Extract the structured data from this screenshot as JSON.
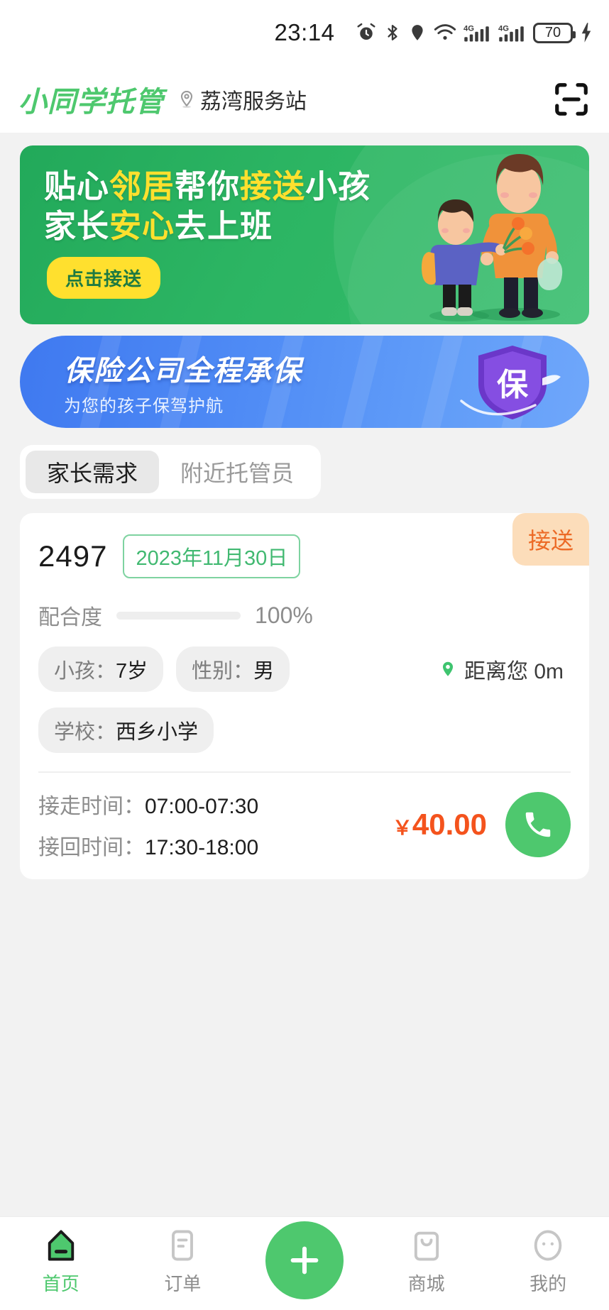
{
  "status_bar": {
    "time": "23:14",
    "battery_level": "70",
    "icons": [
      "alarm-icon",
      "bluetooth-icon",
      "location-icon",
      "wifi-icon",
      "signal-4g-icon",
      "signal-4g-icon",
      "battery-icon",
      "charging-bolt-icon"
    ],
    "network_label": "4G"
  },
  "header": {
    "brand": "小同学托管",
    "station": "荔湾服务站",
    "scan_icon": "scan-icon"
  },
  "hero_banner": {
    "line1_parts": [
      "贴心",
      "邻居",
      "帮你",
      "接送",
      "小孩"
    ],
    "line1_plain_a": "贴心",
    "line1_hl_a": "邻居",
    "line1_plain_b": "帮你",
    "line1_hl_b": "接送",
    "line1_plain_c": "小孩",
    "line2_plain_a": "家长",
    "line2_hl_a": "安心",
    "line2_plain_b": "去上班",
    "cta": "点击接送",
    "bg_color": "#2cb563",
    "highlight_color": "#ffe02e"
  },
  "insurance_banner": {
    "title": "保险公司全程承保",
    "subtitle": "为您的孩子保驾护航",
    "shield_text": "保",
    "bg_color": "#4f8bf5"
  },
  "tabs": [
    {
      "label": "家长需求",
      "active": true
    },
    {
      "label": "附近托管员",
      "active": false
    }
  ],
  "order_card": {
    "badge": "接送",
    "order_id": "2497",
    "date": "2023年11月30日",
    "cooperation": {
      "label": "配合度",
      "value": "100%",
      "percent": 100,
      "bar_color": "#f2dd4a"
    },
    "tags": [
      {
        "label": "小孩：",
        "value": "7岁"
      },
      {
        "label": "性别：",
        "value": "男"
      },
      {
        "label": "学校：",
        "value": "西乡小学"
      }
    ],
    "distance": "距离您 0m",
    "pickup": {
      "label": "接走时间：",
      "value": "07:00-07:30"
    },
    "return": {
      "label": "接回时间：",
      "value": "17:30-18:00"
    },
    "price": "40.00",
    "currency": "￥",
    "call_icon": "phone-icon"
  },
  "bottom_nav": {
    "items": [
      {
        "label": "首页",
        "icon": "home-icon",
        "active": true
      },
      {
        "label": "订单",
        "icon": "order-list-icon",
        "active": false
      },
      {
        "label": "商城",
        "icon": "shop-bag-icon",
        "active": false
      },
      {
        "label": "我的",
        "icon": "profile-icon",
        "active": false
      }
    ],
    "fab_icon": "plus-icon",
    "accent_color": "#4ec86e"
  }
}
